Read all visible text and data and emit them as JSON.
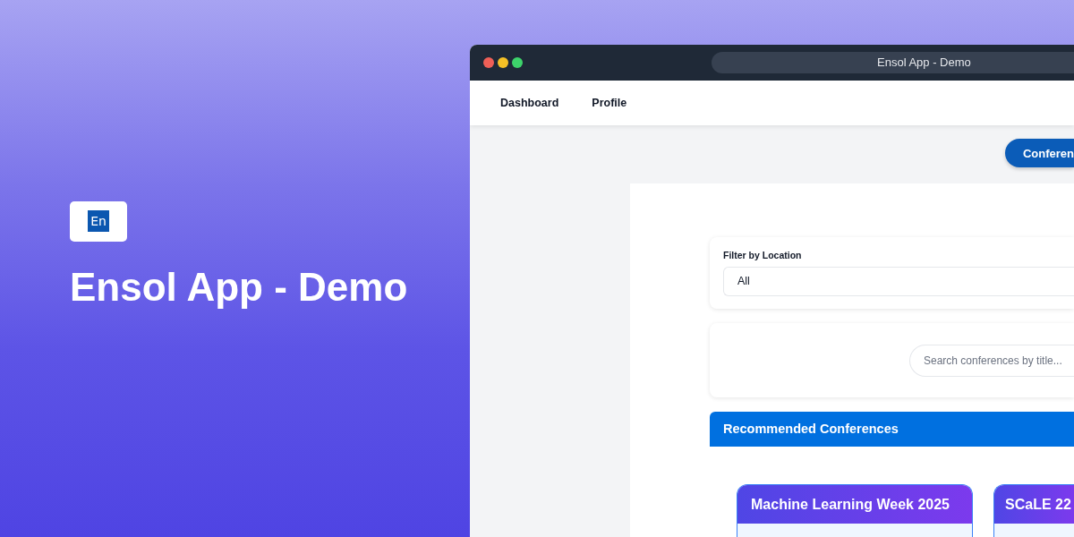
{
  "hero": {
    "logo": "En",
    "title": "Ensol App - Demo"
  },
  "window": {
    "title": "Ensol App - Demo",
    "nav": [
      {
        "label": "Dashboard"
      },
      {
        "label": "Profile"
      }
    ],
    "action_button": "Conferen",
    "filter": {
      "label": "Filter by Location",
      "value": "All"
    },
    "search": {
      "placeholder": "Search conferences by title..."
    },
    "section_title": "Recommended Conferences",
    "conferences": [
      {
        "title": "Machine Learning Week 2025"
      },
      {
        "title": "SCaLE 22"
      }
    ]
  }
}
